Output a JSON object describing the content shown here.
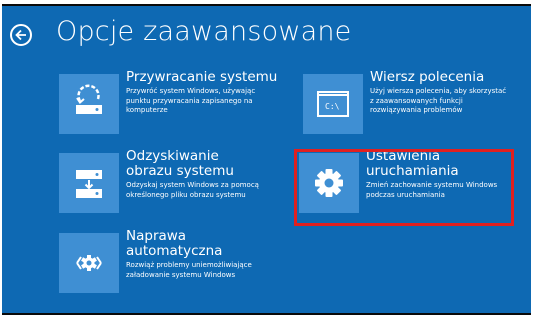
{
  "screen": {
    "title": "Opcje zaawansowane"
  },
  "options": [
    {
      "label": "Przywracanie systemu",
      "description": "Przywróć system Windows, używając punktu przywracania zapisanego na komputerze",
      "icon": "system-restore-icon"
    },
    {
      "label": "Wiersz polecenia",
      "description": "Użyj wiersza polecenia, aby skorzystać z zaawansowanych funkcji rozwiązywania problemów",
      "icon_text": "C:\\",
      "icon": "command-prompt-icon"
    },
    {
      "label": "Odzyskiwanie obrazu systemu",
      "description": "Odzyskaj system Windows za pomocą określonego pliku obrazu systemu",
      "icon": "system-image-icon"
    },
    {
      "label": "Ustawienia uruchamiania",
      "description": "Zmień zachowanie systemu Windows podczas uruchamiania",
      "icon": "gear-icon",
      "highlighted": true
    },
    {
      "label": "Naprawa automatyczna",
      "description": "Rozwiąż problemy uniemożliwiające załadowanie systemu Windows",
      "icon": "automatic-repair-icon"
    }
  ],
  "colors": {
    "background": "#0e69b3",
    "tile": "#3f8fd3",
    "highlight": "#e02020"
  }
}
